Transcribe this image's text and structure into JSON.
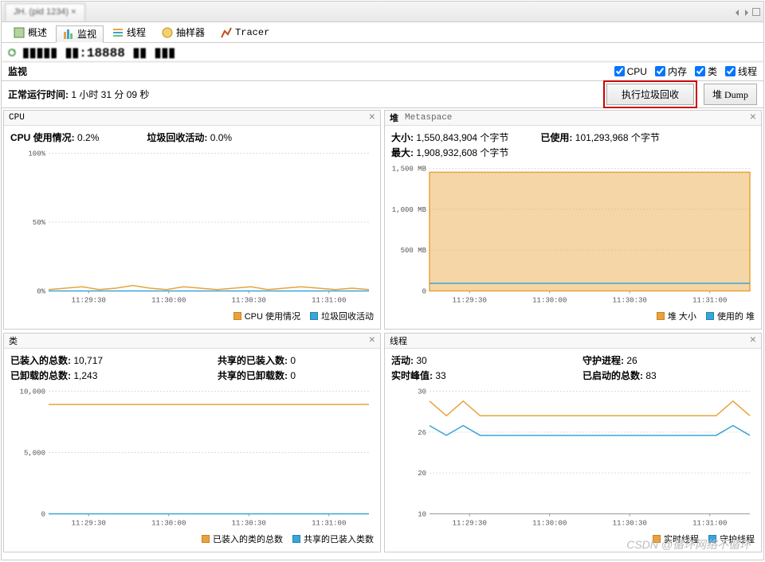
{
  "app_tab_title": "JH. (pid 1234) ×",
  "subtabs": {
    "overview": "概述",
    "monitor": "监视",
    "threads": "线程",
    "sampler": "抽样器",
    "tracer": "Tracer"
  },
  "host_label": "localhost:18888",
  "monitor_section_title": "监视",
  "checkboxes": {
    "cpu": "CPU",
    "memory": "内存",
    "classes": "类",
    "threads": "线程"
  },
  "uptime_label": "正常运行时间:",
  "uptime_value": "1 小时 31 分 09 秒",
  "gc_button": "执行垃圾回收",
  "dump_button": "堆 Dump",
  "cpu_panel": {
    "title": "CPU",
    "usage_label": "CPU 使用情况:",
    "usage_value": "0.2%",
    "gc_label": "垃圾回收活动:",
    "gc_value": "0.0%",
    "legend1": "CPU 使用情况",
    "legend2": "垃圾回收活动"
  },
  "heap_panel": {
    "title1": "堆",
    "title2": "Metaspace",
    "size_label": "大小:",
    "size_value": "1,550,843,904 个字节",
    "max_label": "最大:",
    "max_value": "1,908,932,608 个字节",
    "used_label": "已使用:",
    "used_value": "101,293,968 个字节",
    "legend1": "堆 大小",
    "legend2": "使用的 堆"
  },
  "classes_panel": {
    "title": "类",
    "loaded_label": "已装入的总数:",
    "loaded_value": "10,717",
    "unloaded_label": "已卸载的总数:",
    "unloaded_value": "1,243",
    "shared_loaded_label": "共享的已装入数:",
    "shared_loaded_value": "0",
    "shared_unloaded_label": "共享的已卸载数:",
    "shared_unloaded_value": "0",
    "legend1": "已装入的类的总数",
    "legend2": "共享的已装入类数"
  },
  "threads_panel": {
    "title": "线程",
    "live_label": "活动:",
    "live_value": "30",
    "peak_label": "实时峰值:",
    "peak_value": "33",
    "daemon_label": "守护进程:",
    "daemon_value": "26",
    "started_label": "已启动的总数:",
    "started_value": "83",
    "legend1": "实时线程",
    "legend2": "守护线程"
  },
  "chart_data": [
    {
      "type": "line",
      "panel": "cpu",
      "x_ticks": [
        "11:29:30",
        "11:30:00",
        "11:30:30",
        "11:31:00"
      ],
      "ylim": [
        0,
        100
      ],
      "y_ticks": [
        "0%",
        "50%",
        "100%"
      ],
      "series": [
        {
          "name": "CPU 使用情况",
          "color": "#e8a33c",
          "values": [
            1,
            2,
            3,
            1,
            2,
            4,
            2,
            1,
            3,
            2,
            1,
            2,
            3,
            1,
            2,
            3,
            2,
            1,
            2,
            1
          ]
        },
        {
          "name": "垃圾回收活动",
          "color": "#3aa5d6",
          "values": [
            0,
            0,
            0,
            0,
            0,
            0,
            0,
            0,
            0,
            0,
            0,
            0,
            0,
            0,
            0,
            0,
            0,
            0,
            0,
            0
          ]
        }
      ]
    },
    {
      "type": "area",
      "panel": "heap",
      "x_ticks": [
        "11:29:30",
        "11:30:00",
        "11:30:30",
        "11:31:00"
      ],
      "ylim": [
        0,
        1600
      ],
      "y_ticks": [
        "0",
        "500 MB",
        "1,000 MB",
        "1,500 MB"
      ],
      "series": [
        {
          "name": "堆 大小",
          "color": "#e8a33c",
          "fill": true,
          "values": [
            1550,
            1550,
            1550,
            1550,
            1550,
            1550,
            1550,
            1550,
            1550,
            1550,
            1550,
            1550,
            1550,
            1550,
            1550,
            1550,
            1550,
            1550,
            1550,
            1550
          ]
        },
        {
          "name": "使用的 堆",
          "color": "#3aa5d6",
          "values": [
            100,
            100,
            100,
            100,
            100,
            100,
            100,
            100,
            100,
            100,
            100,
            100,
            100,
            100,
            100,
            100,
            100,
            100,
            100,
            100
          ]
        }
      ]
    },
    {
      "type": "line",
      "panel": "classes",
      "x_ticks": [
        "11:29:30",
        "11:30:00",
        "11:30:30",
        "11:31:00"
      ],
      "ylim": [
        0,
        12000
      ],
      "y_ticks": [
        "0",
        "5,000",
        "10,000"
      ],
      "series": [
        {
          "name": "已装入的类的总数",
          "color": "#e8a33c",
          "values": [
            10700,
            10700,
            10700,
            10700,
            10700,
            10700,
            10700,
            10700,
            10700,
            10700,
            10700,
            10700,
            10700,
            10700,
            10700,
            10700,
            10700,
            10700,
            10700,
            10717
          ]
        },
        {
          "name": "共享的已装入类数",
          "color": "#3aa5d6",
          "values": [
            0,
            0,
            0,
            0,
            0,
            0,
            0,
            0,
            0,
            0,
            0,
            0,
            0,
            0,
            0,
            0,
            0,
            0,
            0,
            0
          ]
        }
      ]
    },
    {
      "type": "line",
      "panel": "threads",
      "x_ticks": [
        "11:29:30",
        "11:30:00",
        "11:30:30",
        "11:31:00"
      ],
      "ylim": [
        10,
        35
      ],
      "y_ticks": [
        "10",
        "20",
        "26",
        "30"
      ],
      "series": [
        {
          "name": "实时线程",
          "color": "#e8a33c",
          "values": [
            33,
            30,
            33,
            30,
            30,
            30,
            30,
            30,
            30,
            30,
            30,
            30,
            30,
            30,
            30,
            30,
            30,
            30,
            33,
            30
          ]
        },
        {
          "name": "守护线程",
          "color": "#3aa5d6",
          "values": [
            28,
            26,
            28,
            26,
            26,
            26,
            26,
            26,
            26,
            26,
            26,
            26,
            26,
            26,
            26,
            26,
            26,
            26,
            28,
            26
          ]
        }
      ]
    }
  ],
  "watermark": "CSDN @循环网络不循环"
}
